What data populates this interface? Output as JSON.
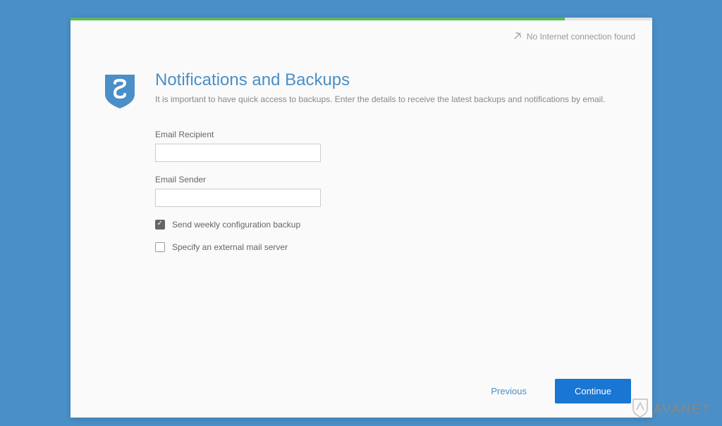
{
  "status": {
    "text": "No Internet connection found"
  },
  "page": {
    "title": "Notifications and Backups",
    "subtitle": "It is important to have quick access to backups. Enter the details to receive the latest backups and notifications by email."
  },
  "form": {
    "recipient": {
      "label": "Email Recipient",
      "value": ""
    },
    "sender": {
      "label": "Email Sender",
      "value": ""
    },
    "weekly_backup": {
      "label": "Send weekly configuration backup",
      "checked": true
    },
    "external_server": {
      "label": "Specify an external mail server",
      "checked": false
    }
  },
  "footer": {
    "previous": "Previous",
    "continue": "Continue"
  },
  "watermark": {
    "text": "AVANET"
  },
  "progress": {
    "percent": 85
  },
  "colors": {
    "background": "#4a8fc7",
    "accent": "#1976d2",
    "progress": "#5cb85c"
  }
}
